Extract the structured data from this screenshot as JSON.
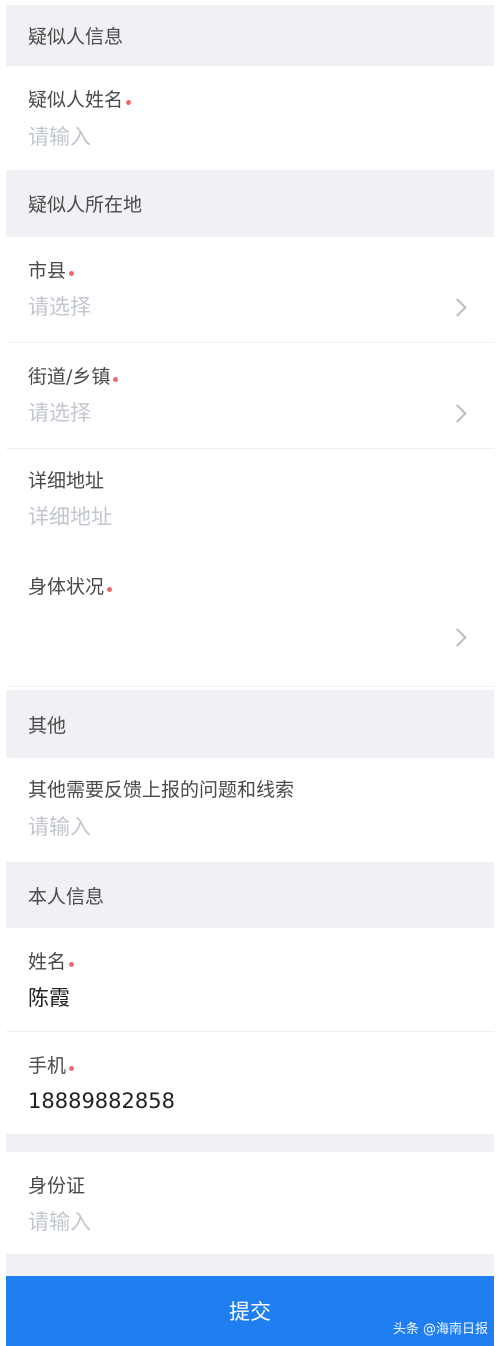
{
  "sections": {
    "suspect_info": "疑似人信息",
    "suspect_location": "疑似人所在地",
    "other": "其他",
    "self_info": "本人信息"
  },
  "fields": {
    "suspect_name": {
      "label": "疑似人姓名",
      "placeholder": "请输入"
    },
    "city_county": {
      "label": "市县",
      "placeholder": "请选择"
    },
    "street_town": {
      "label": "街道/乡镇",
      "placeholder": "请选择"
    },
    "detail_address": {
      "label": "详细地址",
      "placeholder": "详细地址"
    },
    "health_status": {
      "label": "身体状况",
      "placeholder": ""
    },
    "other_feedback": {
      "label": "其他需要反馈上报的问题和线索",
      "placeholder": "请输入"
    },
    "self_name": {
      "label": "姓名",
      "value": "陈霞"
    },
    "phone": {
      "label": "手机",
      "value": "18889882858"
    },
    "id_card": {
      "label": "身份证",
      "placeholder": "请输入"
    }
  },
  "submit_label": "提交",
  "watermark": "头条 @海南日报",
  "colors": {
    "accent": "#1f7ef0",
    "section_bg": "#f0f1f4",
    "required_dot": "#f06a6a",
    "placeholder": "#c2c6cf"
  }
}
